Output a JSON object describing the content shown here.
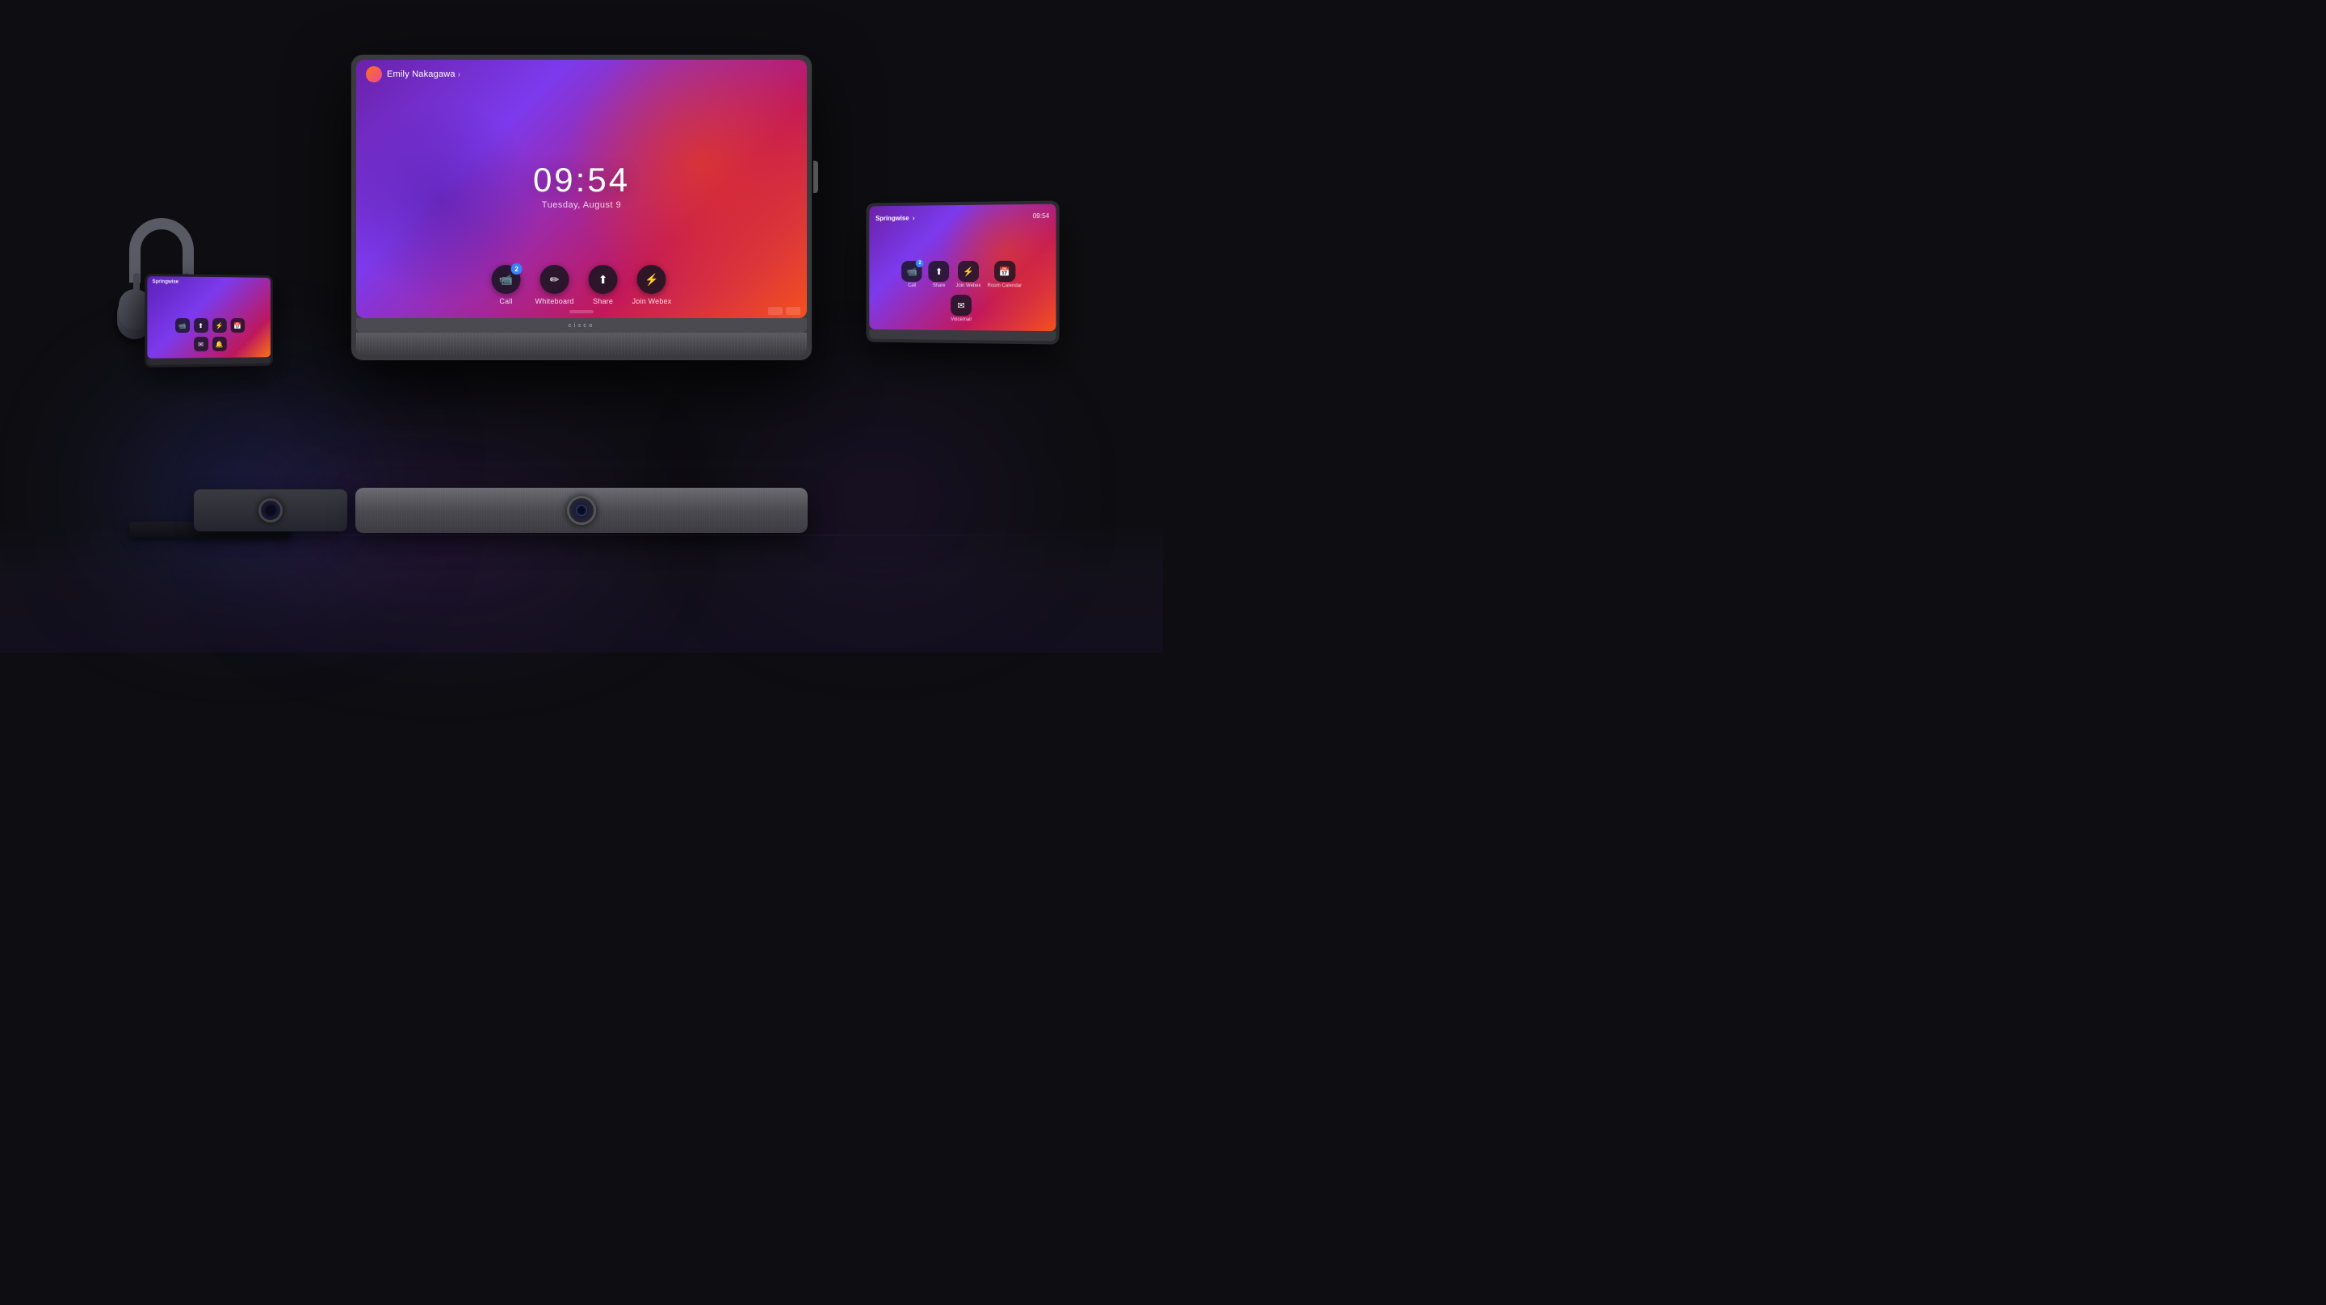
{
  "background": "#0e0e12",
  "main_monitor": {
    "user_name": "Emily Nakagawa",
    "chevron": "›",
    "time": "09:54",
    "date": "Tuesday, August 9",
    "actions": [
      {
        "id": "call",
        "label": "Call",
        "icon": "📹",
        "badge": "2",
        "has_badge": true
      },
      {
        "id": "whiteboard",
        "label": "Whiteboard",
        "icon": "✏",
        "badge": null,
        "has_badge": false
      },
      {
        "id": "share",
        "label": "Share",
        "icon": "↑",
        "badge": null,
        "has_badge": false
      },
      {
        "id": "join-webex",
        "label": "Join Webex",
        "icon": "⚡",
        "badge": null,
        "has_badge": false
      }
    ],
    "cisco_label": "cisco"
  },
  "tablet": {
    "brand": "Springwise",
    "chevron": "›",
    "time": "09:54",
    "icons": [
      {
        "id": "call",
        "label": "Call",
        "icon": "📹",
        "badge": "2",
        "has_badge": true
      },
      {
        "id": "share",
        "label": "Share",
        "icon": "↑",
        "badge": null,
        "has_badge": false
      },
      {
        "id": "join-webex",
        "label": "Join Webex",
        "icon": "⚡",
        "badge": null,
        "has_badge": false
      },
      {
        "id": "room-calendar",
        "label": "Room Calendar",
        "icon": "📅",
        "badge": null,
        "has_badge": false
      },
      {
        "id": "voicemail",
        "label": "Voicemail",
        "icon": "✉",
        "badge": null,
        "has_badge": false
      }
    ]
  },
  "small_device": {
    "brand": "Springwise",
    "icons": [
      {
        "id": "icon1",
        "icon": "📹"
      },
      {
        "id": "icon2",
        "icon": "↑"
      },
      {
        "id": "icon3",
        "icon": "⚡"
      },
      {
        "id": "icon4",
        "icon": "📅"
      },
      {
        "id": "icon5",
        "icon": "✉"
      },
      {
        "id": "icon6",
        "icon": "🔔"
      }
    ]
  }
}
